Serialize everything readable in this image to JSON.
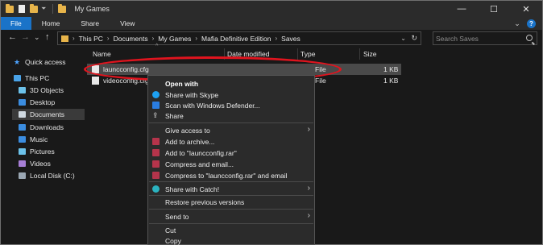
{
  "window": {
    "title": "My Games",
    "minimize": "—",
    "maximize": "☐",
    "close": "✕"
  },
  "ribbon": {
    "tabs": [
      "File",
      "Home",
      "Share",
      "View"
    ]
  },
  "nav": {
    "back": "←",
    "forward": "→",
    "recent": "⌄",
    "up": "↑",
    "breadcrumb": [
      "This PC",
      "Documents",
      "My Games",
      "Mafia Definitive Edition",
      "Saves"
    ],
    "search_placeholder": "Search Saves"
  },
  "sidebar": {
    "items": [
      {
        "label": "Quick access",
        "icon": "star-icon"
      },
      {
        "label": "This PC",
        "icon": "pc-icon"
      },
      {
        "label": "3D Objects",
        "icon": "3d-objects-icon"
      },
      {
        "label": "Desktop",
        "icon": "desktop-icon"
      },
      {
        "label": "Documents",
        "icon": "documents-icon"
      },
      {
        "label": "Downloads",
        "icon": "downloads-icon"
      },
      {
        "label": "Music",
        "icon": "music-icon"
      },
      {
        "label": "Pictures",
        "icon": "pictures-icon"
      },
      {
        "label": "Videos",
        "icon": "videos-icon"
      },
      {
        "label": "Local Disk (C:)",
        "icon": "disk-icon"
      }
    ]
  },
  "files": {
    "columns": [
      "Name",
      "Date modified",
      "Type",
      "Size"
    ],
    "rows": [
      {
        "name": "launcconfig.cfg",
        "type": "File",
        "size": "1 KB"
      },
      {
        "name": "videoconfig.cfg",
        "type": "File",
        "size": "1 KB"
      }
    ]
  },
  "context_menu": {
    "items": [
      {
        "label": "Open with",
        "bold": true,
        "icon": ""
      },
      {
        "label": "Share with Skype",
        "icon": "skype-icon"
      },
      {
        "label": "Scan with Windows Defender...",
        "icon": "defender-icon"
      },
      {
        "label": "Share",
        "icon": "share-icon"
      },
      {
        "label": "Give access to",
        "icon": "",
        "submenu": true
      },
      {
        "label": "Add to archive...",
        "icon": "winrar-icon"
      },
      {
        "label": "Add to \"launcconfig.rar\"",
        "icon": "winrar-icon"
      },
      {
        "label": "Compress and email...",
        "icon": "winrar-icon"
      },
      {
        "label": "Compress to \"launcconfig.rar\" and email",
        "icon": "winrar-icon"
      },
      {
        "label": "Share with Catch!",
        "icon": "catch-icon",
        "submenu": true
      },
      {
        "label": "Restore previous versions",
        "icon": ""
      },
      {
        "label": "Send to",
        "icon": "",
        "submenu": true
      },
      {
        "label": "Cut",
        "icon": ""
      },
      {
        "label": "Copy",
        "icon": ""
      }
    ]
  },
  "colors": {
    "accent": "#1a73c8",
    "annotation": "#e0141e",
    "folder": "#e7b44a"
  }
}
